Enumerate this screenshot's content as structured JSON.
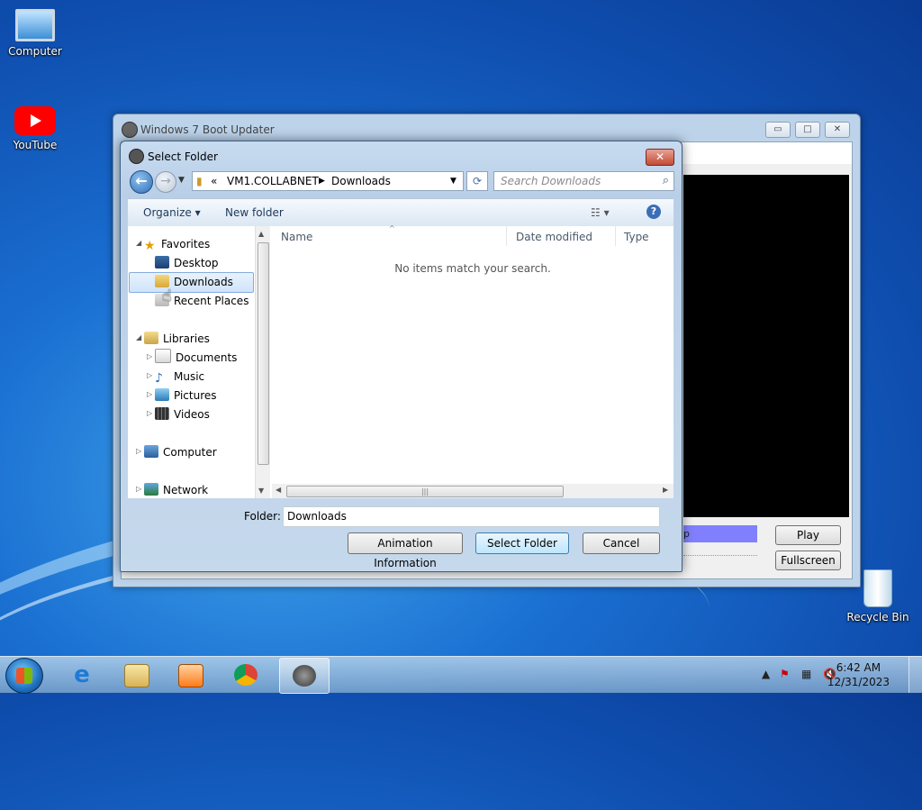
{
  "desktop": {
    "icons": [
      {
        "label": "Computer",
        "icon": "computer-icon"
      },
      {
        "label": "YouTube",
        "icon": "youtube-icon"
      },
      {
        "label": "Recycle Bin",
        "icon": "recycle-bin-icon"
      }
    ]
  },
  "app_window": {
    "title": "Windows 7 Boot Updater",
    "progress_text": "p",
    "play_label": "Play",
    "fullscreen_label": "Fullscreen"
  },
  "dialog": {
    "title": "Select Folder",
    "close_glyph": "✕",
    "address": {
      "chevrons": "«",
      "segments": [
        "VM1.COLLABNET",
        "Downloads"
      ]
    },
    "search_placeholder": "Search Downloads",
    "toolbar": {
      "organize": "Organize ▾",
      "new_folder": "New folder",
      "help": "?"
    },
    "tree": {
      "favorites": "Favorites",
      "desktop": "Desktop",
      "downloads": "Downloads",
      "recent_places": "Recent Places",
      "libraries": "Libraries",
      "documents": "Documents",
      "music": "Music",
      "pictures": "Pictures",
      "videos": "Videos",
      "computer": "Computer",
      "network": "Network"
    },
    "columns": [
      "Name",
      "Date modified",
      "Type"
    ],
    "empty_message": "No items match your search.",
    "folder_label": "Folder:",
    "folder_value": "Downloads",
    "buttons": {
      "animation_info": "Animation Information",
      "select": "Select Folder",
      "cancel": "Cancel"
    }
  },
  "taskbar": {
    "pinned": [
      "internet-explorer-icon",
      "file-explorer-icon",
      "media-player-icon",
      "chrome-icon",
      "boot-updater-icon"
    ],
    "time": "6:42 AM",
    "date": "12/31/2023"
  },
  "colors": {
    "accent": "#3c7fb1",
    "selection": "#cfe4fb",
    "progress": "#8080ff",
    "close": "#c44a35"
  }
}
